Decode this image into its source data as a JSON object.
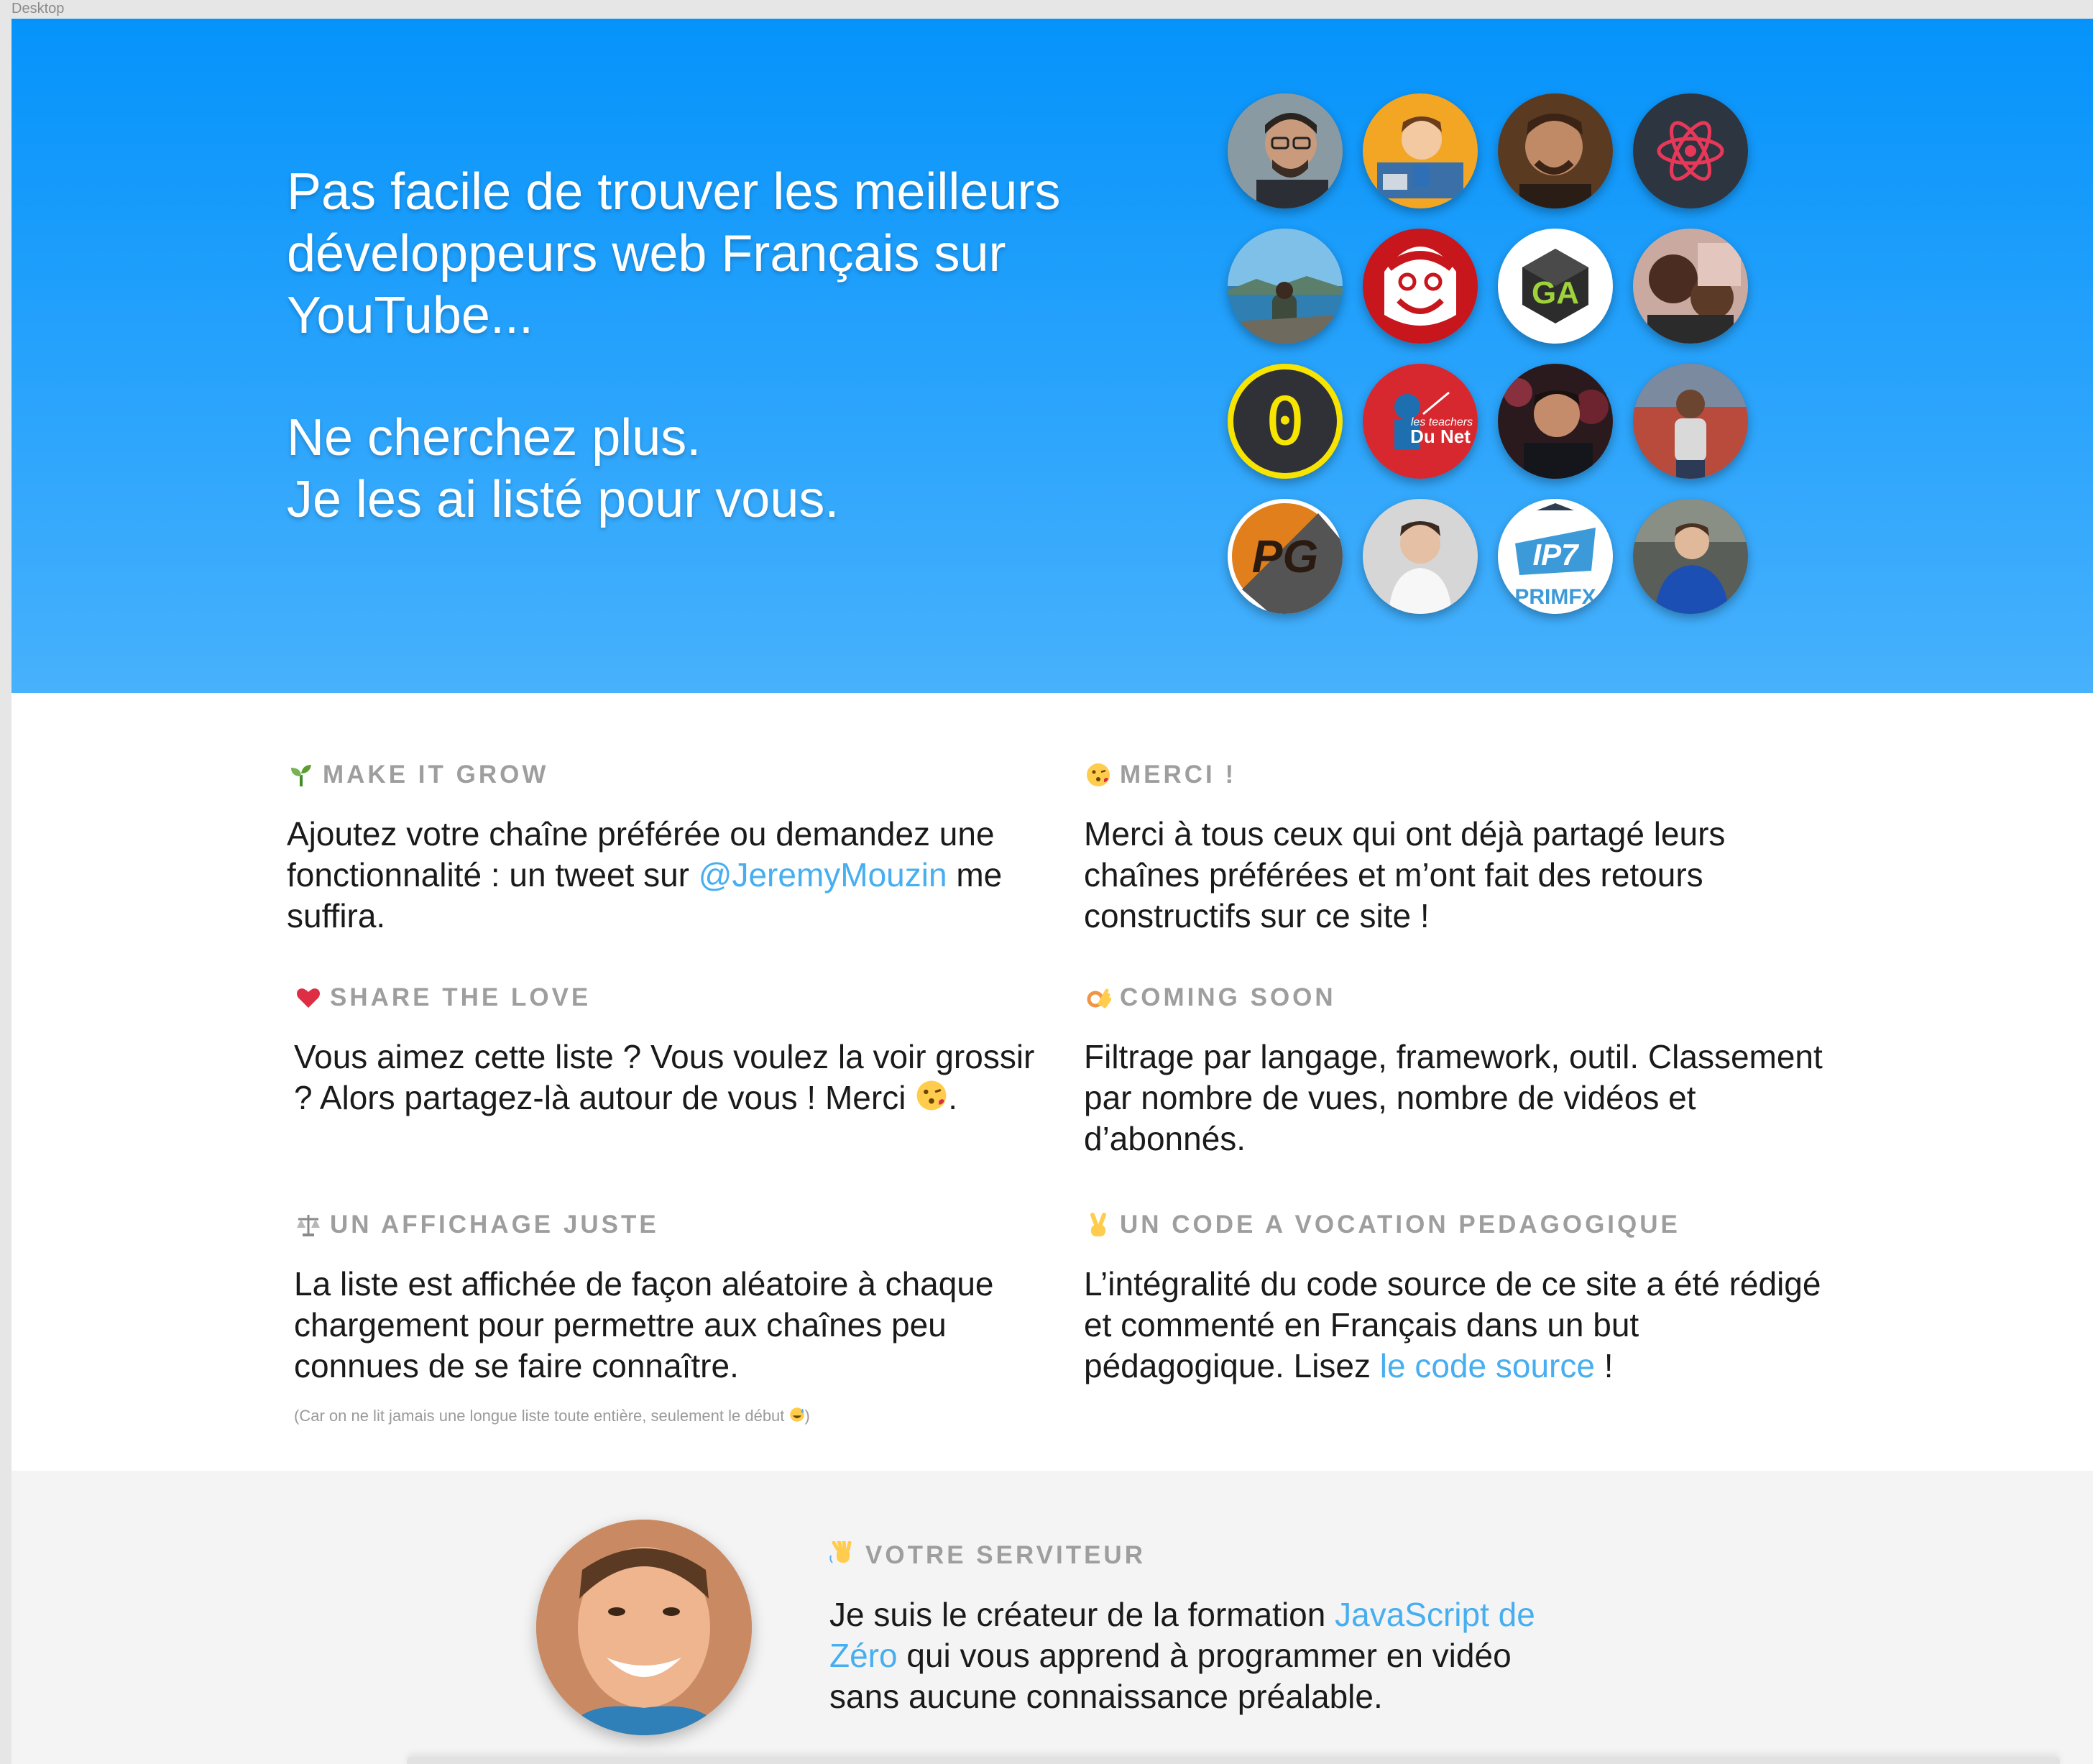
{
  "window": {
    "label": "Desktop"
  },
  "hero": {
    "line1": "Pas facile de trouver les meilleurs",
    "line2": "développeurs web Français sur",
    "line3": "YouTube...",
    "line4": "Ne cherchez plus.",
    "line5": "Je les ai listé pour vous."
  },
  "avatars": [
    {
      "name": "channel-avatar-1"
    },
    {
      "name": "channel-avatar-2"
    },
    {
      "name": "channel-avatar-3"
    },
    {
      "name": "channel-avatar-react"
    },
    {
      "name": "channel-avatar-5"
    },
    {
      "name": "channel-avatar-6"
    },
    {
      "name": "channel-avatar-ga"
    },
    {
      "name": "channel-avatar-8"
    },
    {
      "name": "channel-avatar-zero"
    },
    {
      "name": "channel-avatar-teachers"
    },
    {
      "name": "channel-avatar-11"
    },
    {
      "name": "channel-avatar-12"
    },
    {
      "name": "channel-avatar-pg"
    },
    {
      "name": "channel-avatar-14"
    },
    {
      "name": "channel-avatar-primfx"
    },
    {
      "name": "channel-avatar-16"
    }
  ],
  "avatar_labels": {
    "teachers_top": "les teachers",
    "teachers_bottom": "Du Net",
    "primfx": "PRIMFX",
    "pg": "PG",
    "zero": "0",
    "ga": "GA"
  },
  "features": {
    "grow": {
      "title": "MAKE IT GROW",
      "text_before": "Ajoutez votre chaîne préférée ou demandez une fonctionnalité : un tweet sur ",
      "link": "@JeremyMouzin",
      "text_after": " me suffira."
    },
    "merci": {
      "title": "MERCI !",
      "text": "Merci à tous ceux qui ont déjà partagé leurs chaînes préférées et m’ont fait des retours constructifs sur ce site !"
    },
    "share": {
      "title": "SHARE THE LOVE",
      "text": "Vous aimez cette liste ? Vous voulez la voir grossir ? Alors partagez-là autour de vous ! Merci",
      "text_end": "."
    },
    "soon": {
      "title": "COMING SOON",
      "text": "Filtrage par langage, framework, outil. Classement par nombre de vues, nombre de vidéos et d’abonnés."
    },
    "fair": {
      "title": "UN AFFICHAGE JUSTE",
      "text": "La liste est affichée de façon aléatoire à chaque chargement pour permettre aux chaînes peu connues de se faire connaître.",
      "note_before": "(Car on ne lit jamais une longue liste toute entière, seulement le début ",
      "note_after": ")"
    },
    "code": {
      "title": "UN CODE A VOCATION PEDAGOGIQUE",
      "text_before": "L’intégralité du code source de ce site a été rédigé et commenté en Français dans un but pédagogique. Lisez ",
      "link": "le code source",
      "text_after": " !"
    }
  },
  "author": {
    "title": "VOTRE SERVITEUR",
    "text_before": "Je suis le créateur de la formation ",
    "link": "JavaScript de Zéro",
    "text_after": " qui vous apprend à programmer en vidéo sans aucune connaissance préalable."
  },
  "colors": {
    "hero_top": "#0593fb",
    "hero_bottom": "#47b1fc",
    "link": "#47aef0",
    "heading": "#9e9e9e"
  }
}
